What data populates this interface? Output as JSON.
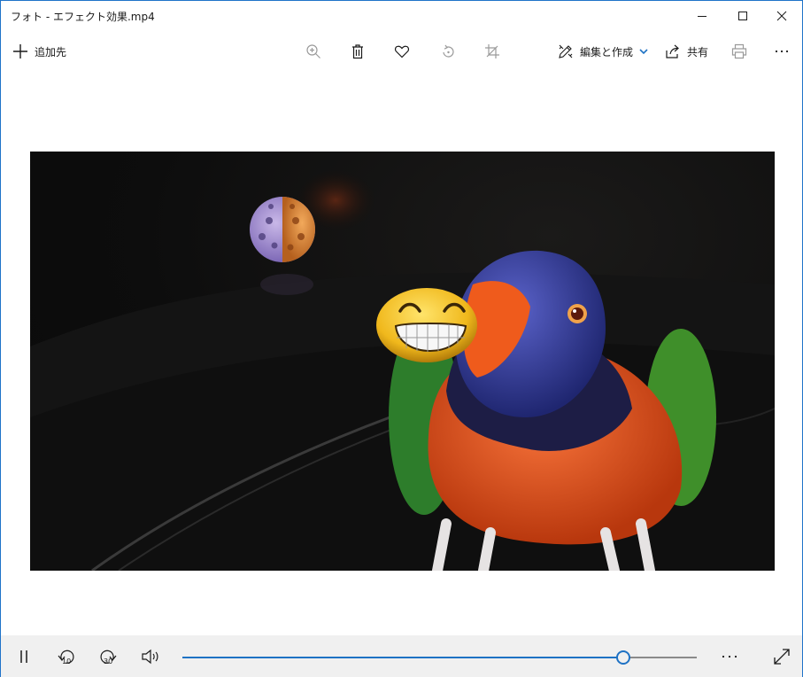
{
  "window": {
    "title": "フォト - エフェクト効果.mp4",
    "controls": [
      "minimize",
      "maximize",
      "close"
    ]
  },
  "toolbar": {
    "add_to_label": "追加先",
    "edit_create_label": "編集と作成",
    "share_label": "共有",
    "icons": [
      "plus-icon",
      "zoom-in-icon",
      "trash-icon",
      "heart-icon",
      "rotate-icon",
      "crop-icon",
      "edit-create-icon",
      "chevron-down-icon",
      "share-icon",
      "print-icon",
      "more-icon"
    ],
    "accent": "#1e72c4"
  },
  "video": {
    "description_sticker": "grinning-emoji-sticker",
    "colors": {
      "background": "#0d0d0d",
      "parrot_head": "#3b44a8",
      "parrot_body": "#e9541e",
      "emoji": "#f2c21f"
    }
  },
  "player": {
    "skip_back_seconds": "10",
    "skip_forward_seconds": "30",
    "progress": 0.858,
    "icons": [
      "pause-icon",
      "skip-back-icon",
      "skip-forward-icon",
      "volume-icon",
      "more-icon",
      "fullscreen-icon"
    ]
  }
}
